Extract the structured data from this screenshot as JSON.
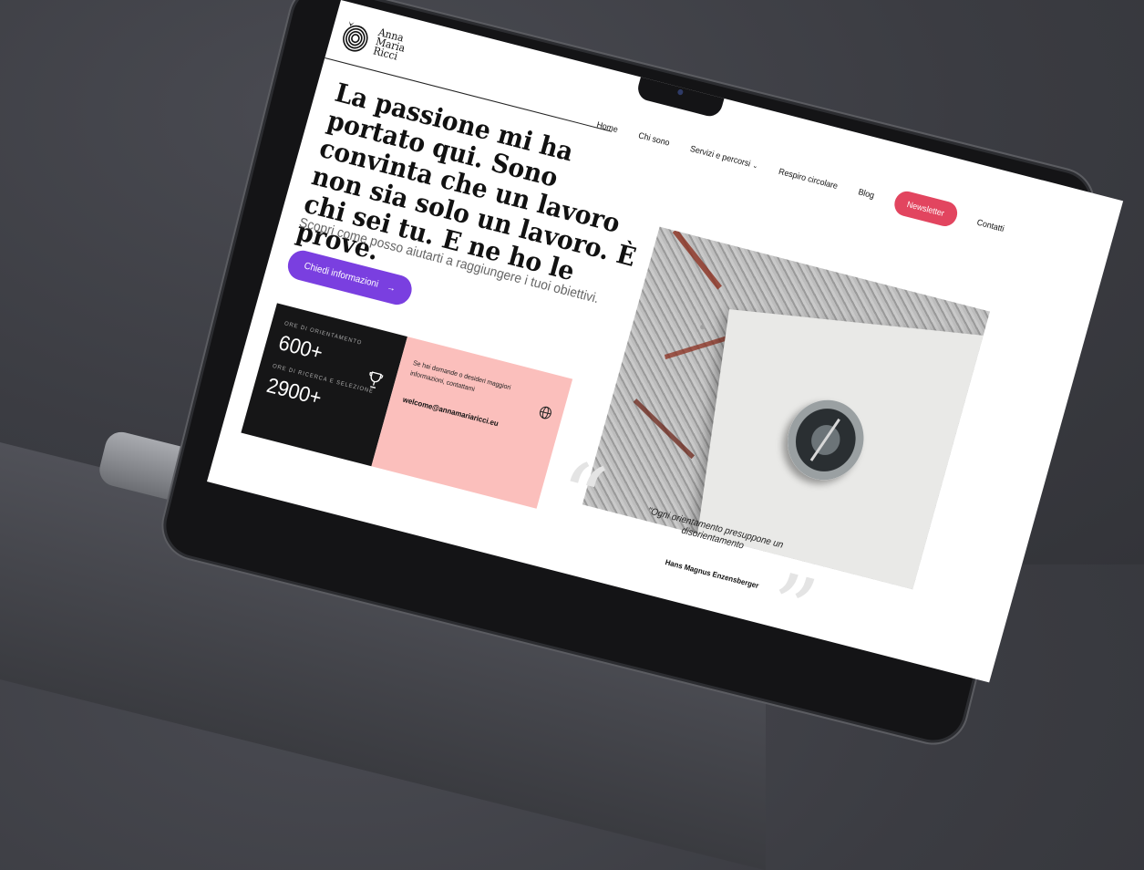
{
  "brand": {
    "name_line1": "Anna",
    "name_line2": "Maria",
    "name_line3": "Ricci"
  },
  "nav": {
    "items": [
      {
        "label": "Home"
      },
      {
        "label": "Chi sono"
      },
      {
        "label": "Servizi e percorsi"
      },
      {
        "label": "Respiro circolare"
      },
      {
        "label": "Blog"
      }
    ],
    "newsletter_label": "Newsletter",
    "contacts_label": "Contatti"
  },
  "hero": {
    "headline": "La passione mi ha portato qui. Sono convinta che un lavoro non sia solo un lavoro. È chi sei tu. E ne ho le prove.",
    "subline": "Scopri come posso aiutarti a raggiungere i tuoi obiettivi.",
    "cta_label": "Chiedi informazioni",
    "cta_arrow": "→"
  },
  "stats": [
    {
      "label": "ORE DI ORIENTAMENTO",
      "value": "600+"
    },
    {
      "label": "ORE DI RICERCA E SELEZIONE",
      "value": "2900+"
    }
  ],
  "contact": {
    "text": "Se hai domande o desideri maggiori informazioni, contattami",
    "email": "welcome@annamariaricci.eu"
  },
  "quote": {
    "text": "\"Ogni orientamento presuppone un disorientamento",
    "author": "Hans Magnus Enzensberger"
  },
  "icons": {
    "trophy": "trophy-icon",
    "globe": "globe-icon",
    "arrow": "arrow-right-icon",
    "logo": "spiral-logo-icon"
  },
  "colors": {
    "accent_purple": "#7a3fe0",
    "accent_red": "#e2455f",
    "pink_panel": "#fbbfbc",
    "dark_panel": "#161617"
  }
}
